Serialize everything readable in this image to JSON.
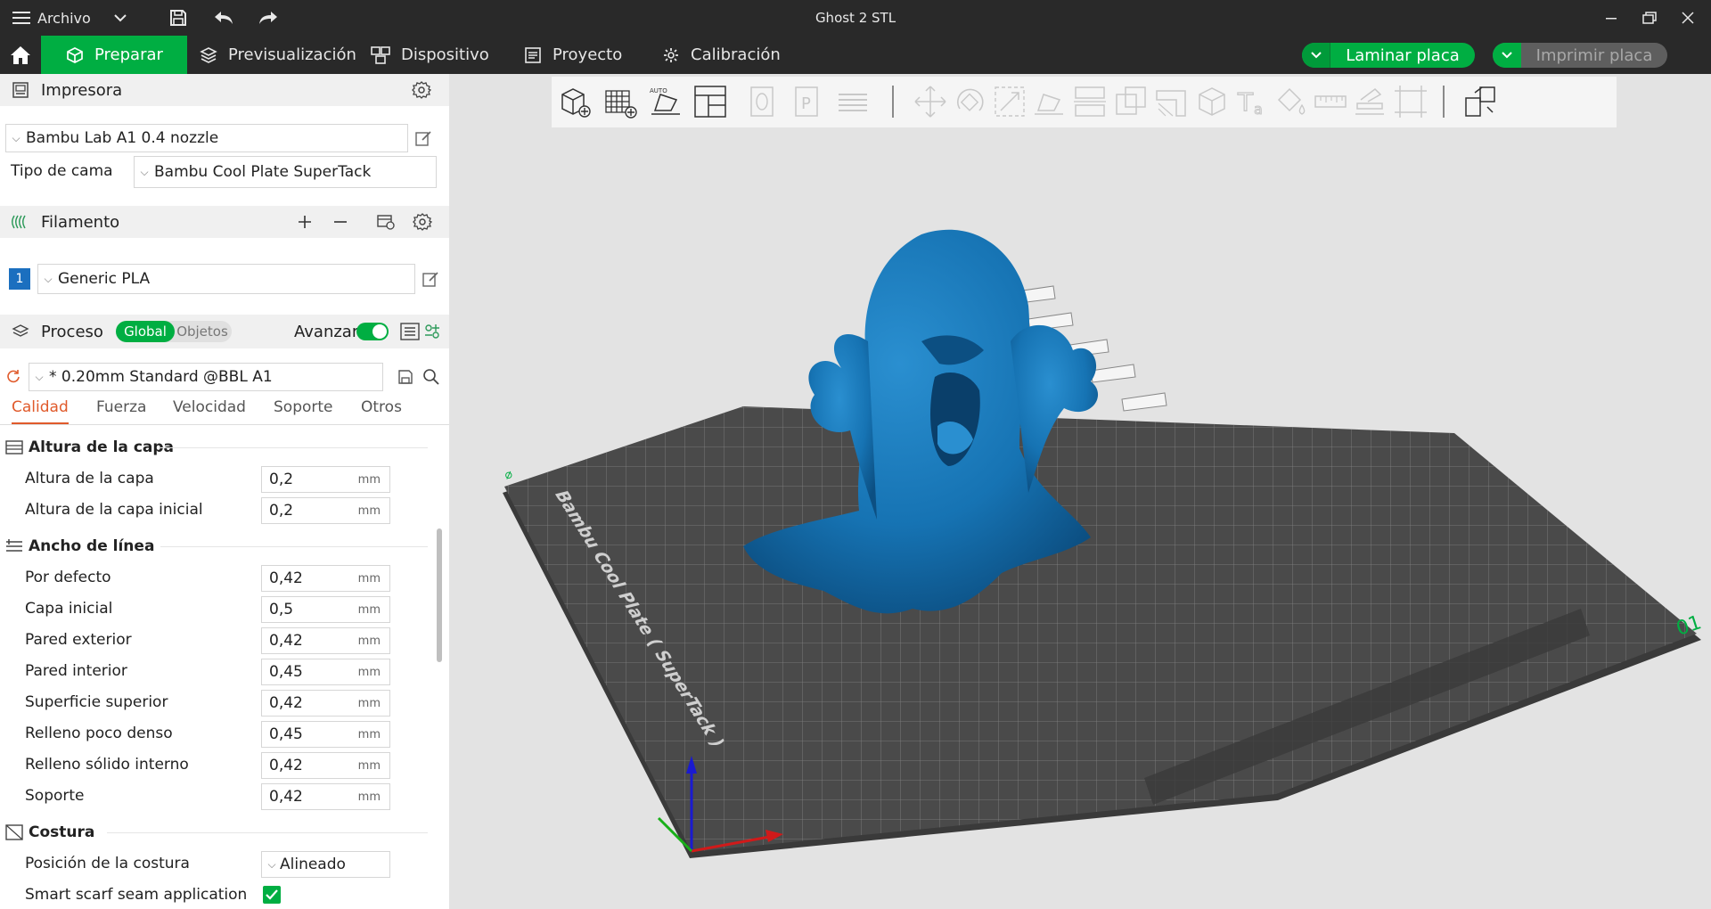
{
  "window": {
    "title": "Ghost 2 STL",
    "menu_label": "Archivo"
  },
  "nav": {
    "tabs": [
      {
        "label": "Preparar",
        "active": true
      },
      {
        "label": "Previsualización"
      },
      {
        "label": "Dispositivo"
      },
      {
        "label": "Proyecto"
      },
      {
        "label": "Calibración"
      }
    ],
    "slice_label": "Laminar placa",
    "print_label": "Imprimir placa"
  },
  "printer": {
    "header": "Impresora",
    "selected": "Bambu Lab A1 0.4 nozzle",
    "bed_label": "Tipo de cama",
    "bed_value": "Bambu Cool Plate SuperTack"
  },
  "filament": {
    "header": "Filamento",
    "slot_number": "1",
    "slot_color": "#1b6fbf",
    "selected": "Generic PLA"
  },
  "process": {
    "header": "Proceso",
    "toggle_global": "Global",
    "toggle_objects": "Objetos",
    "advanced_label": "Avanzar",
    "advanced_on": true,
    "preset": "* 0.20mm Standard @BBL A1",
    "tabs": [
      "Calidad",
      "Fuerza",
      "Velocidad",
      "Soporte",
      "Otros"
    ],
    "active_tab": "Calidad"
  },
  "settings": {
    "layer_group": "Altura de la capa",
    "layer_rows": [
      {
        "label": "Altura de la capa",
        "value": "0,2",
        "unit": "mm"
      },
      {
        "label": "Altura de la capa inicial",
        "value": "0,2",
        "unit": "mm"
      }
    ],
    "width_group": "Ancho de línea",
    "width_rows": [
      {
        "label": "Por defecto",
        "value": "0,42",
        "unit": "mm"
      },
      {
        "label": "Capa inicial",
        "value": "0,5",
        "unit": "mm"
      },
      {
        "label": "Pared exterior",
        "value": "0,42",
        "unit": "mm"
      },
      {
        "label": "Pared interior",
        "value": "0,45",
        "unit": "mm"
      },
      {
        "label": "Superficie superior",
        "value": "0,42",
        "unit": "mm"
      },
      {
        "label": "Relleno poco denso",
        "value": "0,45",
        "unit": "mm"
      },
      {
        "label": "Relleno sólido interno",
        "value": "0,42",
        "unit": "mm"
      },
      {
        "label": "Soporte",
        "value": "0,42",
        "unit": "mm"
      }
    ],
    "seam_group": "Costura",
    "seam_position_label": "Posición de la costura",
    "seam_position_value": "Alineado",
    "scarf_label": "Smart scarf seam application",
    "scarf_checked": true
  },
  "viewport": {
    "plate_label": "Bambu Cool Plate ( SuperTack )",
    "plate_number": "01",
    "model_color": "#1673b3",
    "accent": "#00ae42"
  }
}
